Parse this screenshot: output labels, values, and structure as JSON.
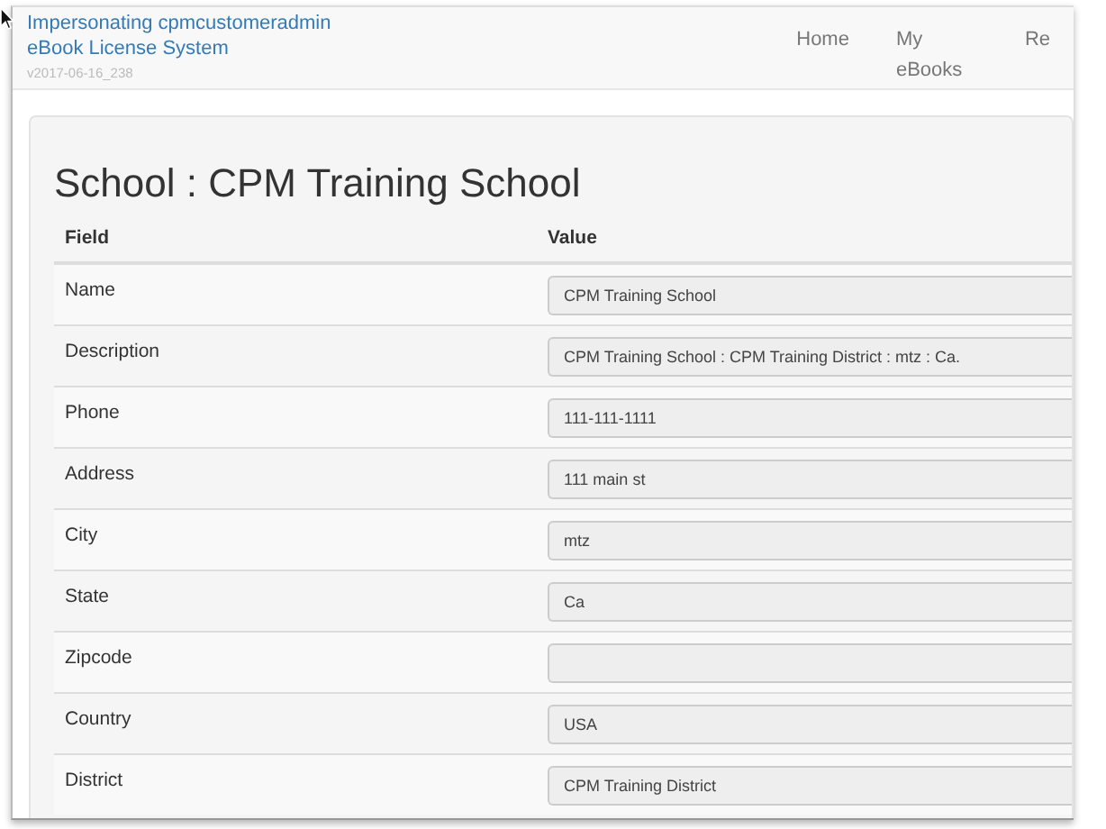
{
  "navbar": {
    "impersonation": "Impersonating cpmcustomeradmin",
    "brand": "eBook License System",
    "version": "v2017-06-16_238",
    "links": [
      {
        "label": "Home"
      },
      {
        "label": "My eBooks"
      },
      {
        "label": "Re"
      }
    ]
  },
  "title": "School : CPM Training School",
  "table": {
    "columns": [
      "Field",
      "Value"
    ],
    "rows": [
      {
        "field": "Name",
        "value": "CPM Training School"
      },
      {
        "field": "Description",
        "value": "CPM Training School : CPM Training District : mtz : Ca."
      },
      {
        "field": "Phone",
        "value": "111-111-1111"
      },
      {
        "field": "Address",
        "value": "111 main st"
      },
      {
        "field": "City",
        "value": "mtz"
      },
      {
        "field": "State",
        "value": "Ca"
      },
      {
        "field": "Zipcode"
      },
      {
        "field": "Country",
        "value": "USA"
      },
      {
        "field": "District",
        "value": "CPM Training District"
      }
    ]
  }
}
